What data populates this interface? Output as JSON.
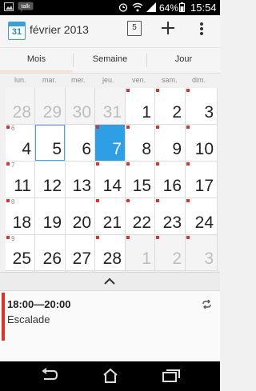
{
  "status_bar": {
    "notifications": [
      "image-icon",
      "talk-icon"
    ],
    "battery_percent": "64%",
    "time": "15:54"
  },
  "action_bar": {
    "month_title": "février 2013",
    "app_icon_day": "31",
    "today_button_day": "5"
  },
  "view_tabs": [
    "Mois",
    "Semaine",
    "Jour"
  ],
  "weekdays": [
    "lun.",
    "mar.",
    "mer.",
    "jeu.",
    "ven.",
    "sam.",
    "dim."
  ],
  "weeks": [
    {
      "week_number": "",
      "days": [
        {
          "day": "28",
          "other": true,
          "event": false
        },
        {
          "day": "29",
          "other": true,
          "event": false
        },
        {
          "day": "30",
          "other": true,
          "event": false
        },
        {
          "day": "31",
          "other": true,
          "event": false
        },
        {
          "day": "1",
          "other": false,
          "event": true
        },
        {
          "day": "2",
          "other": false,
          "event": true
        },
        {
          "day": "3",
          "other": false,
          "event": true
        }
      ]
    },
    {
      "week_number": "6",
      "days": [
        {
          "day": "4",
          "other": false,
          "event": true
        },
        {
          "day": "5",
          "other": false,
          "event": false,
          "selected": true
        },
        {
          "day": "6",
          "other": false,
          "event": false
        },
        {
          "day": "7",
          "other": false,
          "event": true,
          "today": true
        },
        {
          "day": "8",
          "other": false,
          "event": true
        },
        {
          "day": "9",
          "other": false,
          "event": true
        },
        {
          "day": "10",
          "other": false,
          "event": true
        }
      ]
    },
    {
      "week_number": "7",
      "days": [
        {
          "day": "11",
          "other": false,
          "event": true
        },
        {
          "day": "12",
          "other": false,
          "event": false
        },
        {
          "day": "13",
          "other": false,
          "event": false
        },
        {
          "day": "14",
          "other": false,
          "event": true
        },
        {
          "day": "15",
          "other": false,
          "event": true
        },
        {
          "day": "16",
          "other": false,
          "event": true
        },
        {
          "day": "17",
          "other": false,
          "event": true
        }
      ]
    },
    {
      "week_number": "8",
      "days": [
        {
          "day": "18",
          "other": false,
          "event": true
        },
        {
          "day": "19",
          "other": false,
          "event": false
        },
        {
          "day": "20",
          "other": false,
          "event": false
        },
        {
          "day": "21",
          "other": false,
          "event": true
        },
        {
          "day": "22",
          "other": false,
          "event": true
        },
        {
          "day": "23",
          "other": false,
          "event": true
        },
        {
          "day": "24",
          "other": false,
          "event": true
        }
      ]
    },
    {
      "week_number": "9",
      "days": [
        {
          "day": "25",
          "other": false,
          "event": true
        },
        {
          "day": "26",
          "other": false,
          "event": false
        },
        {
          "day": "27",
          "other": false,
          "event": false
        },
        {
          "day": "28",
          "other": false,
          "event": true
        },
        {
          "day": "1",
          "other": true,
          "event": true
        },
        {
          "day": "2",
          "other": true,
          "event": true
        },
        {
          "day": "3",
          "other": true,
          "event": true
        }
      ]
    }
  ],
  "agenda": {
    "time_range": "18:00—20:00",
    "title": "Escalade",
    "accent_color": "#e0322c"
  },
  "colors": {
    "today": "#2e9fe5",
    "event_marker": "#e0322c"
  }
}
